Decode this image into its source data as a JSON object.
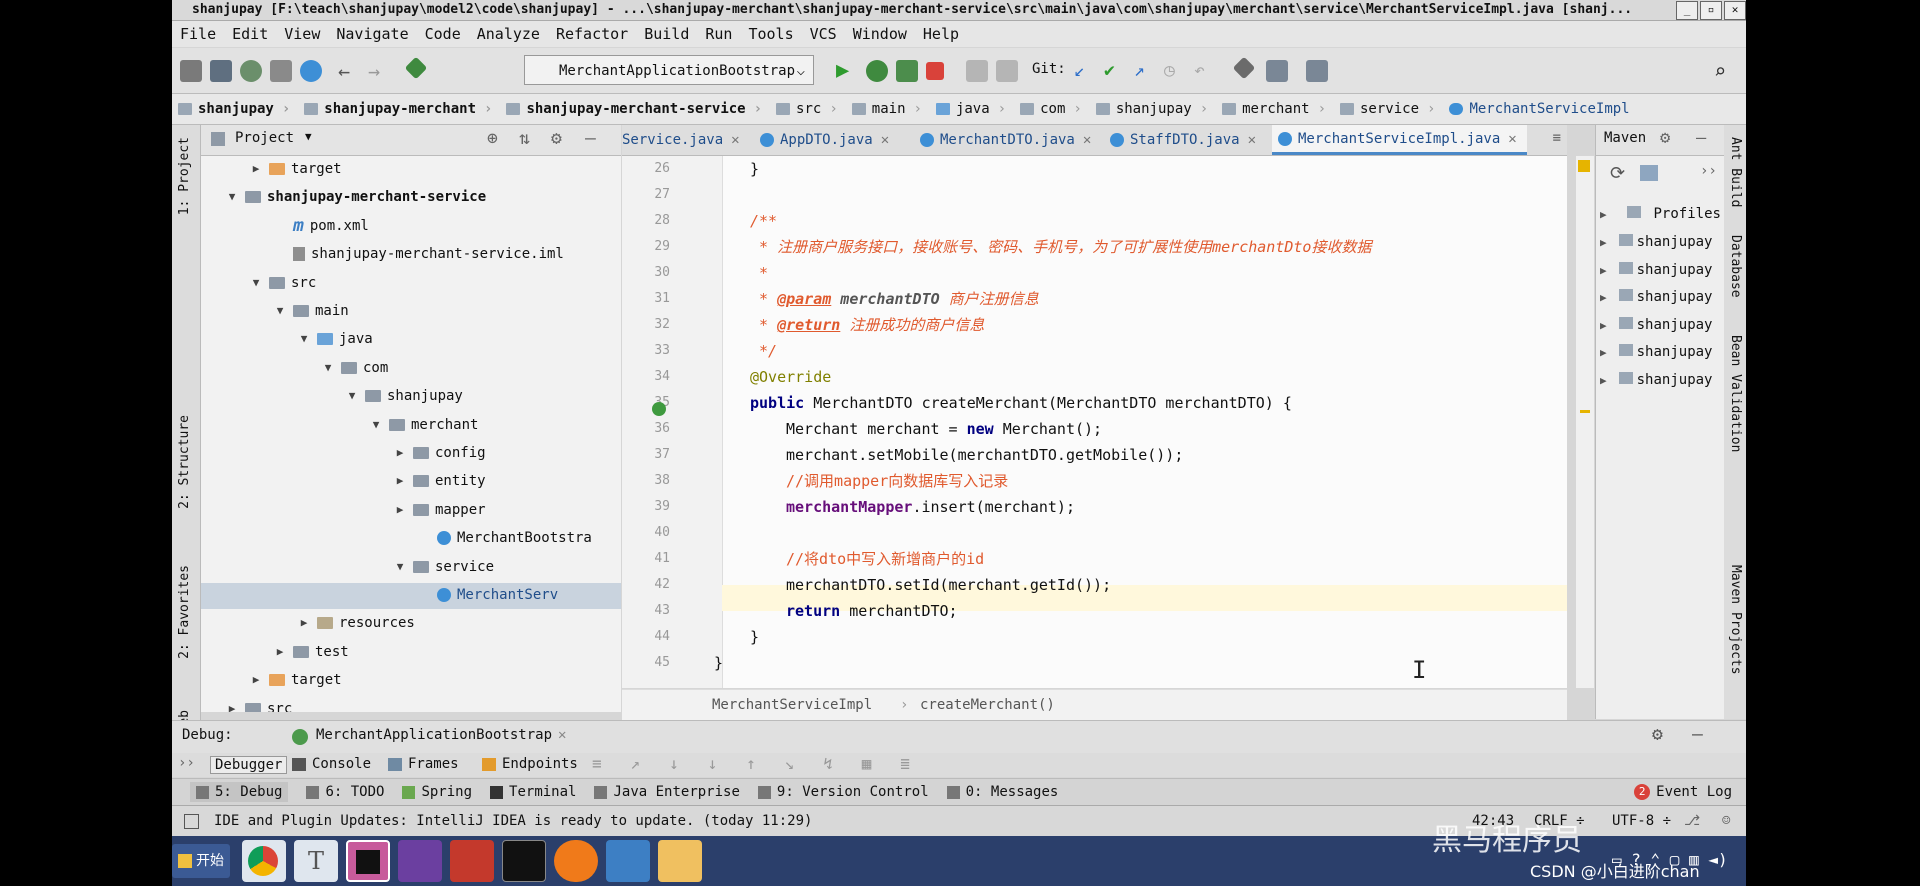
{
  "window": {
    "title": "shanjupay [F:\\teach\\shanjupay\\model2\\code\\shanjupay] - ...\\shanjupay-merchant\\shanjupay-merchant-service\\src\\main\\java\\com\\shanjupay\\merchant\\service\\MerchantServiceImpl.java [shanj..."
  },
  "menu": [
    "File",
    "Edit",
    "View",
    "Navigate",
    "Code",
    "Analyze",
    "Refactor",
    "Build",
    "Run",
    "Tools",
    "VCS",
    "Window",
    "Help"
  ],
  "toolbar": {
    "run_config": "MerchantApplicationBootstrap",
    "git_label": "Git:"
  },
  "breadcrumbs": [
    "shanjupay",
    "shanjupay-merchant",
    "shanjupay-merchant-service",
    "src",
    "main",
    "java",
    "com",
    "shanjupay",
    "merchant",
    "service",
    "MerchantServiceImpl"
  ],
  "project_panel": {
    "title": "Project",
    "tree": [
      {
        "label": "target",
        "depth": 3,
        "arrow": "▶",
        "kind": "orange"
      },
      {
        "label": "shanjupay-merchant-service",
        "depth": 2,
        "arrow": "▼",
        "kind": "module"
      },
      {
        "label": "pom.xml",
        "depth": 4,
        "arrow": "",
        "kind": "maven"
      },
      {
        "label": "shanjupay-merchant-service.iml",
        "depth": 4,
        "arrow": "",
        "kind": "file"
      },
      {
        "label": "src",
        "depth": 3,
        "arrow": "▼",
        "kind": "folder"
      },
      {
        "label": "main",
        "depth": 4,
        "arrow": "▼",
        "kind": "folder"
      },
      {
        "label": "java",
        "depth": 5,
        "arrow": "▼",
        "kind": "blue"
      },
      {
        "label": "com",
        "depth": 6,
        "arrow": "▼",
        "kind": "folder"
      },
      {
        "label": "shanjupay",
        "depth": 7,
        "arrow": "▼",
        "kind": "folder"
      },
      {
        "label": "merchant",
        "depth": 8,
        "arrow": "▼",
        "kind": "folder"
      },
      {
        "label": "config",
        "depth": 9,
        "arrow": "▶",
        "kind": "folder"
      },
      {
        "label": "entity",
        "depth": 9,
        "arrow": "▶",
        "kind": "folder"
      },
      {
        "label": "mapper",
        "depth": 9,
        "arrow": "▶",
        "kind": "folder"
      },
      {
        "label": "MerchantBootstra",
        "depth": 10,
        "arrow": "",
        "kind": "class"
      },
      {
        "label": "service",
        "depth": 9,
        "arrow": "▼",
        "kind": "folder"
      },
      {
        "label": "MerchantServ",
        "depth": 10,
        "arrow": "",
        "kind": "class-sel"
      },
      {
        "label": "resources",
        "depth": 5,
        "arrow": "▶",
        "kind": "res"
      },
      {
        "label": "test",
        "depth": 4,
        "arrow": "▶",
        "kind": "folder"
      },
      {
        "label": "target",
        "depth": 3,
        "arrow": "▶",
        "kind": "orange"
      },
      {
        "label": "src",
        "depth": 2,
        "arrow": "▶",
        "kind": "folder"
      }
    ]
  },
  "editor_tabs": [
    "Service.java",
    "AppDTO.java",
    "MerchantDTO.java",
    "StaffDTO.java",
    "MerchantServiceImpl.java"
  ],
  "code": {
    "lines": [
      26,
      27,
      28,
      29,
      30,
      31,
      32,
      33,
      34,
      35,
      36,
      37,
      38,
      39,
      40,
      41,
      42,
      43,
      44,
      45
    ],
    "l26": "}",
    "l28": "/**",
    "l29_a": " * 注册商户服务接口，接收账号、密码、手机号，为了可扩展性使用",
    "l29_b": "merchantDto",
    "l29_c": "接收数据",
    "l30": " *",
    "l31_a": " * ",
    "l31_b": "@param",
    "l31_c": " merchantDTO",
    "l31_d": " 商户注册信息",
    "l32_a": " * ",
    "l32_b": "@return",
    "l32_c": " 注册成功的商户信息",
    "l33": " */",
    "l34": "@Override",
    "l35_kw": "public",
    "l35": " MerchantDTO createMerchant(MerchantDTO merchantDTO) {",
    "l36_a": "Merchant merchant = ",
    "l36_kw": "new",
    "l36_b": " Merchant();",
    "l37": "merchant.setMobile(merchantDTO.getMobile());",
    "l38": "//调用mapper向数据库写入记录",
    "l39_a": "merchantMapper",
    "l39_b": ".insert(merchant);",
    "l41": "//将dto中写入新增商户的id",
    "l42": "merchantDTO.setId(merchant.getId());",
    "l43_kw": "return",
    "l43": " merchantDTO;",
    "l44": "}",
    "l45": "}"
  },
  "editor_breadcrumb": [
    "MerchantServiceImpl",
    "createMerchant()"
  ],
  "maven_panel": {
    "title": "Maven",
    "profiles": "Profiles",
    "items": [
      "shanjupay",
      "shanjupay",
      "shanjupay",
      "shanjupay",
      "shanjupay",
      "shanjupay"
    ]
  },
  "side_labels": {
    "left": [
      "1: Project",
      "2: Structure",
      "2: Favorites",
      "Web"
    ],
    "right": [
      "Ant Build",
      "Database",
      "Bean Validation",
      "Maven Projects"
    ]
  },
  "debug": {
    "label": "Debug:",
    "session": "MerchantApplicationBootstrap",
    "tabs": [
      "Debugger",
      "Console",
      "Frames",
      "Endpoints"
    ]
  },
  "tool_windows": [
    "5: Debug",
    "6: TODO",
    "Spring",
    "Terminal",
    "Java Enterprise",
    "9: Version Control",
    "0: Messages"
  ],
  "event_log": {
    "count": "2",
    "label": "Event Log"
  },
  "status": {
    "message": "IDE and Plugin Updates: IntelliJ IDEA is ready to update. (today 11:29)",
    "position": "42:43",
    "line_sep": "CRLF ÷",
    "encoding": "UTF-8 ÷"
  },
  "taskbar": {
    "start": "开始"
  },
  "watermark": {
    "text": "黑马程序员",
    "credit": "CSDN @小白进阶chan"
  }
}
